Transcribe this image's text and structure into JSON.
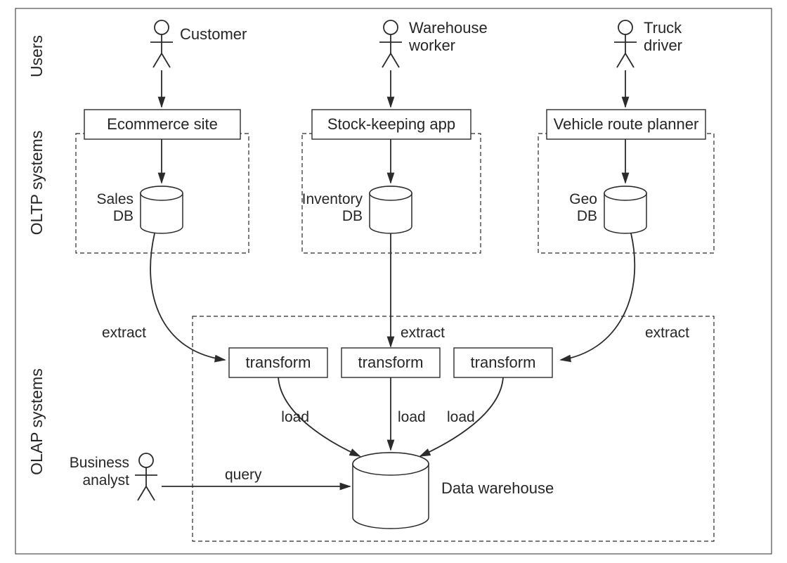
{
  "rows": {
    "users": "Users",
    "oltp": "OLTP systems",
    "olap": "OLAP systems"
  },
  "actors": {
    "customer": "Customer",
    "warehouse_worker_l1": "Warehouse",
    "warehouse_worker_l2": "worker",
    "truck_l1": "Truck",
    "truck_l2": "driver",
    "business_l1": "Business",
    "business_l2": "analyst"
  },
  "apps": {
    "ecommerce": "Ecommerce site",
    "stock": "Stock-keeping app",
    "route": "Vehicle route planner"
  },
  "dbs": {
    "sales_l1": "Sales",
    "sales_l2": "DB",
    "inventory_l1": "Inventory",
    "inventory_l2": "DB",
    "geo_l1": "Geo",
    "geo_l2": "DB",
    "dw": "Data warehouse"
  },
  "etl": {
    "extract": "extract",
    "transform": "transform",
    "load": "load",
    "query": "query"
  }
}
